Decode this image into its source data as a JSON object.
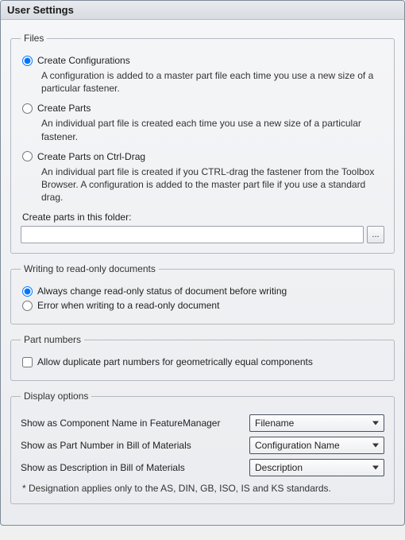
{
  "title": "User Settings",
  "files": {
    "legend": "Files",
    "opt1": {
      "label": "Create Configurations",
      "desc": "A configuration is added to a master part file each time you use a new size of a particular fastener."
    },
    "opt2": {
      "label": "Create Parts",
      "desc": "An individual part file is created each time you use a new size of a particular fastener."
    },
    "opt3": {
      "label": "Create Parts on Ctrl-Drag",
      "desc": "An individual part file is created if you CTRL-drag the fastener from the Toolbox Browser. A configuration is added to the master part file if you use a standard drag."
    },
    "folder_label": "Create parts in this folder:",
    "folder_value": "",
    "browse_label": "..."
  },
  "writing": {
    "legend": "Writing to read-only documents",
    "opt1": "Always change read-only status of document before writing",
    "opt2": "Error when writing to a read-only document"
  },
  "partnumbers": {
    "legend": "Part numbers",
    "chk": "Allow duplicate part numbers for geometrically equal components"
  },
  "display": {
    "legend": "Display options",
    "row1_label": "Show as Component Name in FeatureManager",
    "row1_value": "Filename",
    "row2_label": "Show as Part Number in Bill of Materials",
    "row2_value": "Configuration Name",
    "row3_label": "Show as Description in Bill of Materials",
    "row3_value": "Description",
    "footnote": "* Designation applies only to the AS, DIN, GB, ISO, IS and KS standards."
  }
}
